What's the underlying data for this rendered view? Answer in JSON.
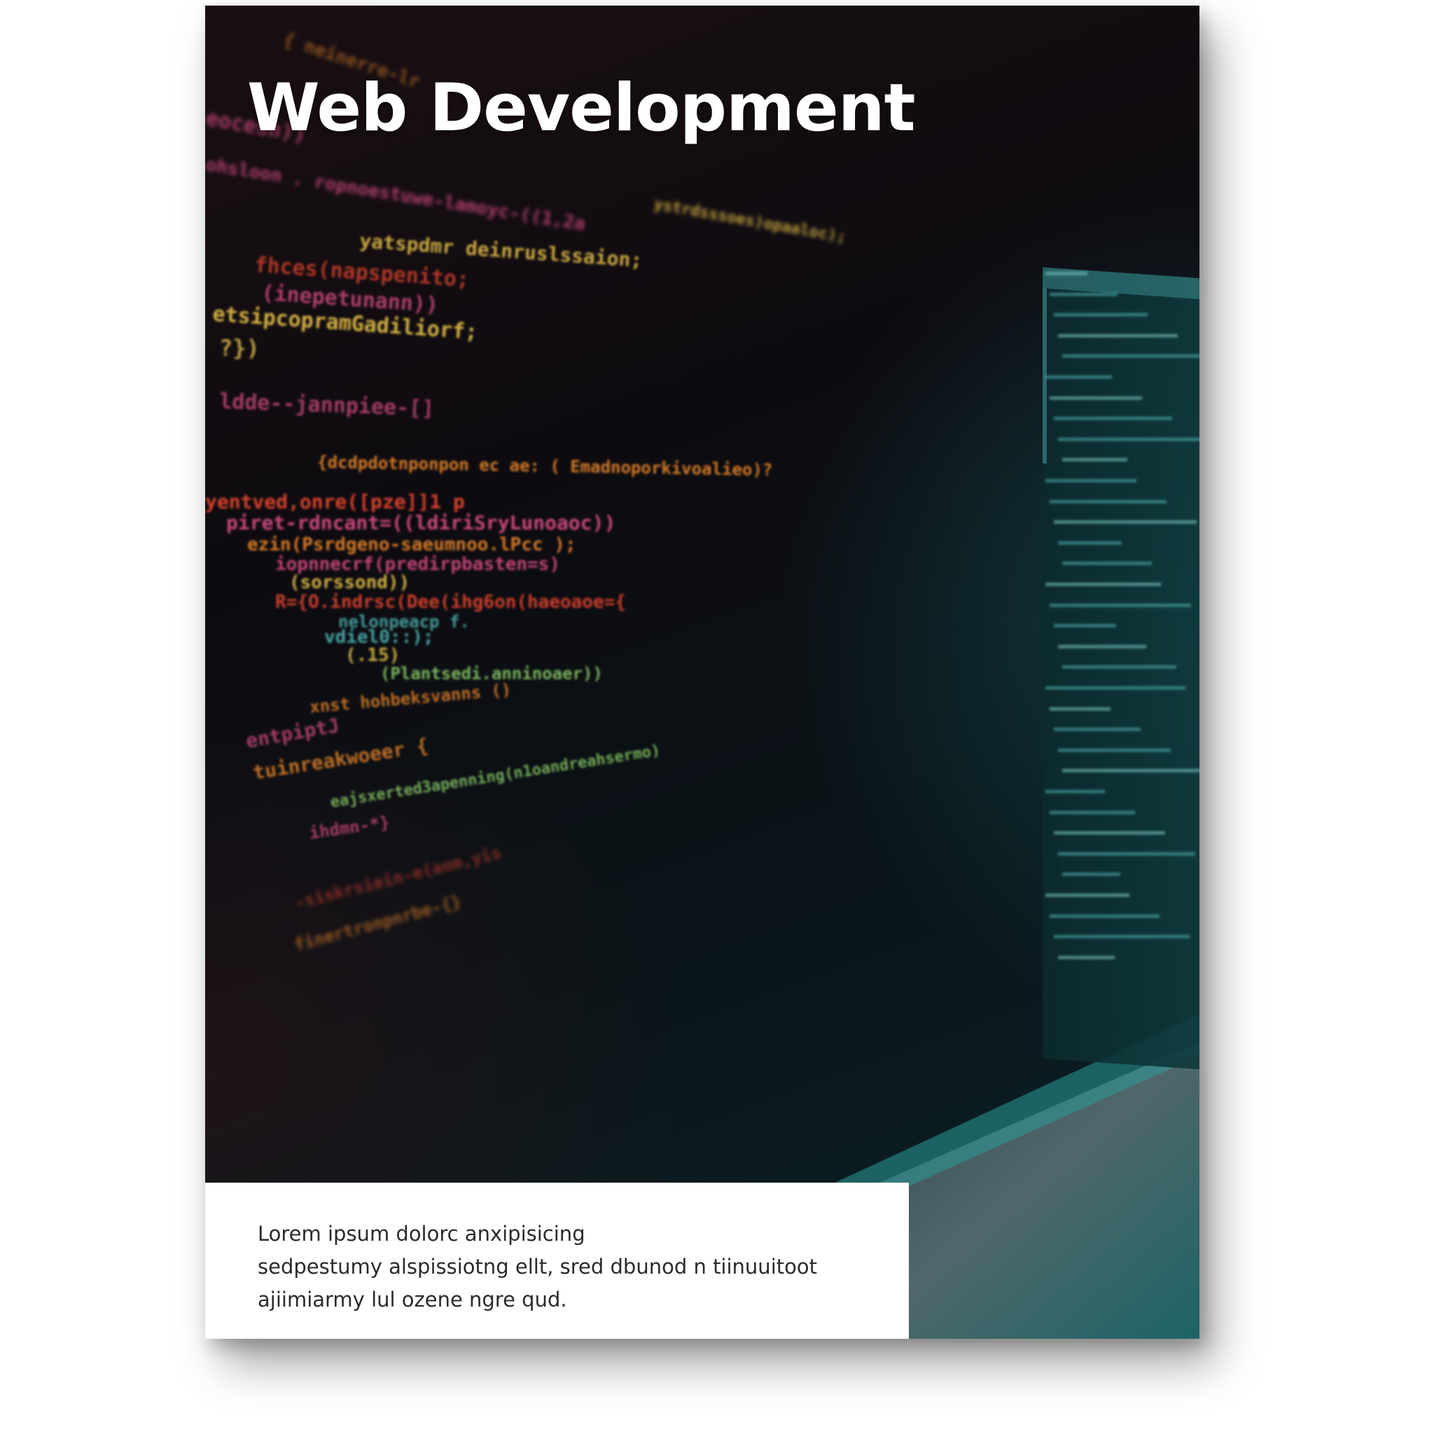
{
  "cover": {
    "title": "Web Development",
    "body_lines": [
      "Lorem ipsum dolorc anxipisicing",
      "sedpestumy alspissiotng ellt, sred dbunod n tiinuuitoot",
      "ajiimiarmy lul ozene ngre qud."
    ]
  },
  "background_image": {
    "subject": "blurred-code-editor-monitor",
    "code_lines": [
      "{ neinerre-lr",
      "eocesn))",
      "ohsloon . ropnoestuwe-lamoyc-((1,2a",
      "ystrdsssoes)opaaloc);",
      "yatspdmr deinruslssaion;",
      "fhces(napspenito;",
      "(inepetunann))",
      "etsipcopramGadiliorf;",
      "?})",
      "ldde--jannpiee-[]",
      "{dcdpdotnponpon ec ae: ( Emadnoporkivoalieo)?",
      "yentved,onre([pze]]1 p",
      "piret-rdncant=((ldiriSryLunoaoc))",
      "ezin(Psrdgeno-saeumnoo.lPcc );",
      "iopnnecrf(predirpbasten=s)",
      "(sorssond))",
      "R={O.indrsc(Dee(ihg6on(haeoaoe={",
      "nelonpeacp f.",
      "vdiel0::);",
      "(.15)",
      "(Plantsedi.anninoaer))",
      "xnst hohbeksvanns ()",
      "entpiptJ",
      "tuinreakwoeer {",
      "eajsxerted3apenning(n1oandreahsermo)",
      "ihdmn-*}",
      "-siskrsiein-e(aom,yis",
      "finertronpnrbe-{}"
    ]
  },
  "colors": {
    "title": "#ffffff",
    "body_text": "#2b2b2b",
    "panel": "#ffffff",
    "code_orange": "#e8862a",
    "code_yellow": "#e7c24a",
    "code_red": "#e2452f",
    "code_pink": "#e0508a",
    "code_teal": "#4fb3b0",
    "code_green": "#8fd36a"
  }
}
